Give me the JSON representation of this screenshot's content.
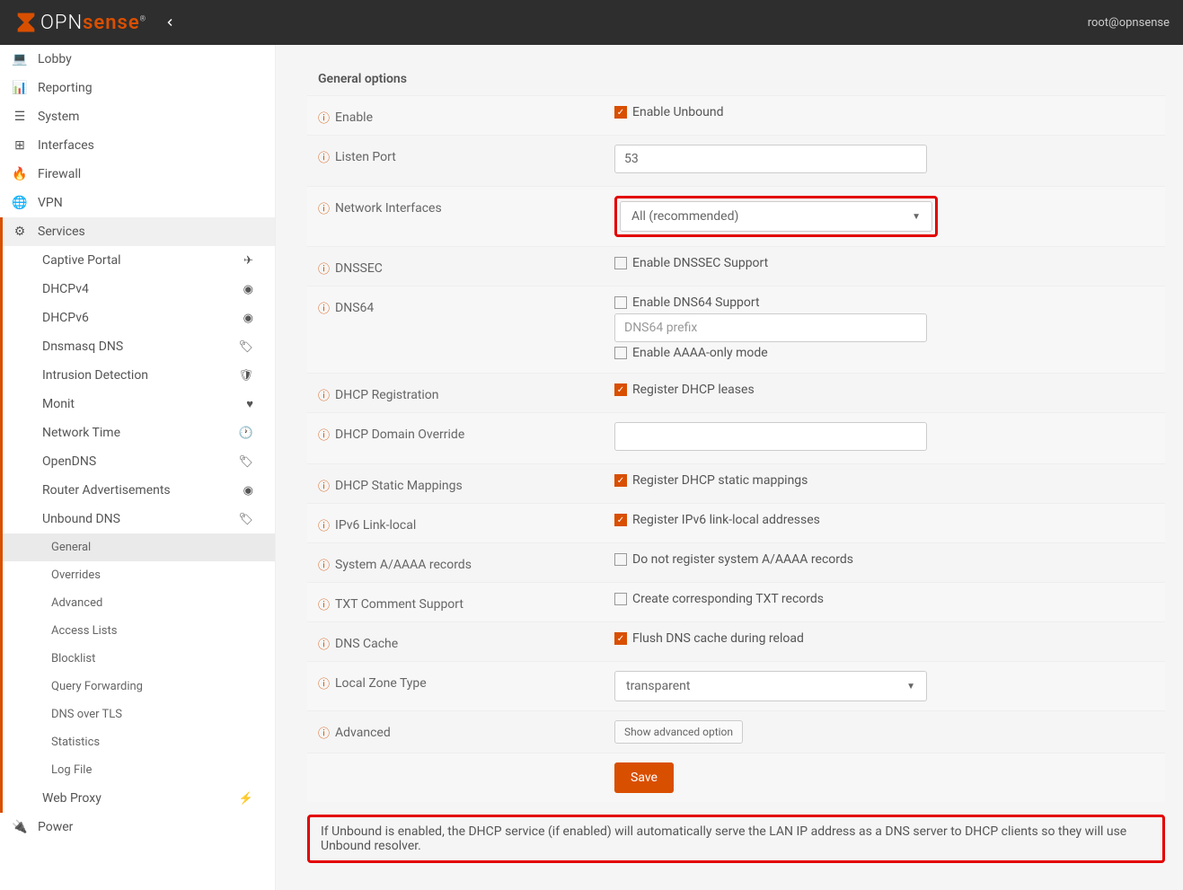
{
  "header": {
    "user_text": "root@opnsense"
  },
  "sidebar": {
    "items": [
      {
        "label": "Lobby"
      },
      {
        "label": "Reporting"
      },
      {
        "label": "System"
      },
      {
        "label": "Interfaces"
      },
      {
        "label": "Firewall"
      },
      {
        "label": "VPN"
      },
      {
        "label": "Services"
      },
      {
        "label": "Power"
      }
    ],
    "services": [
      {
        "label": "Captive Portal"
      },
      {
        "label": "DHCPv4"
      },
      {
        "label": "DHCPv6"
      },
      {
        "label": "Dnsmasq DNS"
      },
      {
        "label": "Intrusion Detection"
      },
      {
        "label": "Monit"
      },
      {
        "label": "Network Time"
      },
      {
        "label": "OpenDNS"
      },
      {
        "label": "Router Advertisements"
      },
      {
        "label": "Unbound DNS"
      },
      {
        "label": "Web Proxy"
      }
    ],
    "unbound": [
      {
        "label": "General"
      },
      {
        "label": "Overrides"
      },
      {
        "label": "Advanced"
      },
      {
        "label": "Access Lists"
      },
      {
        "label": "Blocklist"
      },
      {
        "label": "Query Forwarding"
      },
      {
        "label": "DNS over TLS"
      },
      {
        "label": "Statistics"
      },
      {
        "label": "Log File"
      }
    ]
  },
  "form": {
    "panel_title": "General options",
    "rows": {
      "enable": {
        "label": "Enable",
        "cb_label": "Enable Unbound"
      },
      "listen_port": {
        "label": "Listen Port",
        "value": "53"
      },
      "network_interfaces": {
        "label": "Network Interfaces",
        "value": "All (recommended)"
      },
      "dnssec": {
        "label": "DNSSEC",
        "cb_label": "Enable DNSSEC Support"
      },
      "dns64": {
        "label": "DNS64",
        "cb1": "Enable DNS64 Support",
        "placeholder": "DNS64 prefix",
        "cb2": "Enable AAAA-only mode"
      },
      "dhcp_reg": {
        "label": "DHCP Registration",
        "cb_label": "Register DHCP leases"
      },
      "dhcp_domain": {
        "label": "DHCP Domain Override"
      },
      "dhcp_static": {
        "label": "DHCP Static Mappings",
        "cb_label": "Register DHCP static mappings"
      },
      "ipv6_ll": {
        "label": "IPv6 Link-local",
        "cb_label": "Register IPv6 link-local addresses"
      },
      "sys_aaaa": {
        "label": "System A/AAAA records",
        "cb_label": "Do not register system A/AAAA records"
      },
      "txt": {
        "label": "TXT Comment Support",
        "cb_label": "Create corresponding TXT records"
      },
      "dns_cache": {
        "label": "DNS Cache",
        "cb_label": "Flush DNS cache during reload"
      },
      "local_zone": {
        "label": "Local Zone Type",
        "value": "transparent"
      },
      "advanced": {
        "label": "Advanced",
        "btn": "Show advanced option"
      }
    },
    "save_btn": "Save",
    "info_banner": "If Unbound is enabled, the DHCP service (if enabled) will automatically serve the LAN IP address as a DNS server to DHCP clients so they will use Unbound resolver."
  }
}
